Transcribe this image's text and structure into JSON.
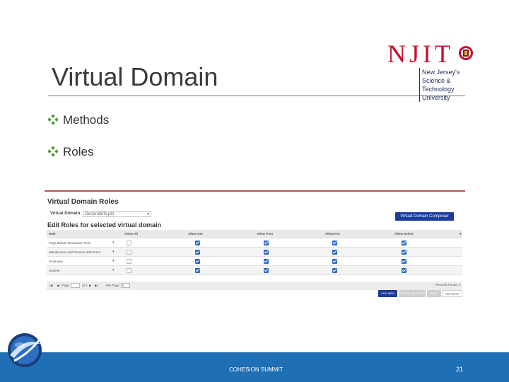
{
  "slide": {
    "title": "Virtual Domain",
    "bullets": [
      "Methods",
      "Roles"
    ],
    "footer_text": "COHESION SUMMIT",
    "page_number": "21"
  },
  "logo": {
    "word": "NJIT",
    "sub_line1": "New Jersey's Science &",
    "sub_line2": "Technology University"
  },
  "screenshot": {
    "heading": "Virtual Domain Roles",
    "domain_label": "Virtual Domain",
    "domain_value": "GeneralInfo.pkt",
    "composer_button": "Virtual Domain Composer",
    "edit_heading": "Edit Roles for selected virtual domain",
    "columns": [
      "Role",
      "Allow All",
      "Allow Get",
      "Allow Post",
      "Allow Put",
      "Allow Delete"
    ],
    "rows": [
      {
        "role": "Page Builder Developer Tools",
        "allow_all": false,
        "get": true,
        "post": true,
        "put": true,
        "delete": true
      },
      {
        "role": "Maintenance Self Service Web Point",
        "allow_all": false,
        "get": true,
        "post": true,
        "put": true,
        "delete": true
      },
      {
        "role": "Employee",
        "allow_all": false,
        "get": true,
        "post": true,
        "put": true,
        "delete": true
      },
      {
        "role": "Student",
        "allow_all": false,
        "get": true,
        "post": true,
        "put": true,
        "delete": true
      }
    ],
    "pager": {
      "page_label": "Page",
      "page_value": "1",
      "of_label": "of 1",
      "per_page_label": "Per Page",
      "per_page_value": "5"
    },
    "records_found": "Records Found: 4",
    "buttons": {
      "add": "ADD NEW",
      "delete": "DELETE SELECTED",
      "save": "SAVE",
      "refresh": "REFRESH"
    }
  },
  "colors": {
    "accent_red": "#c0504d",
    "brand_blue": "#1c3b9c",
    "footer_blue": "#1f6fb5",
    "bullet_green": "#4aa23a"
  }
}
